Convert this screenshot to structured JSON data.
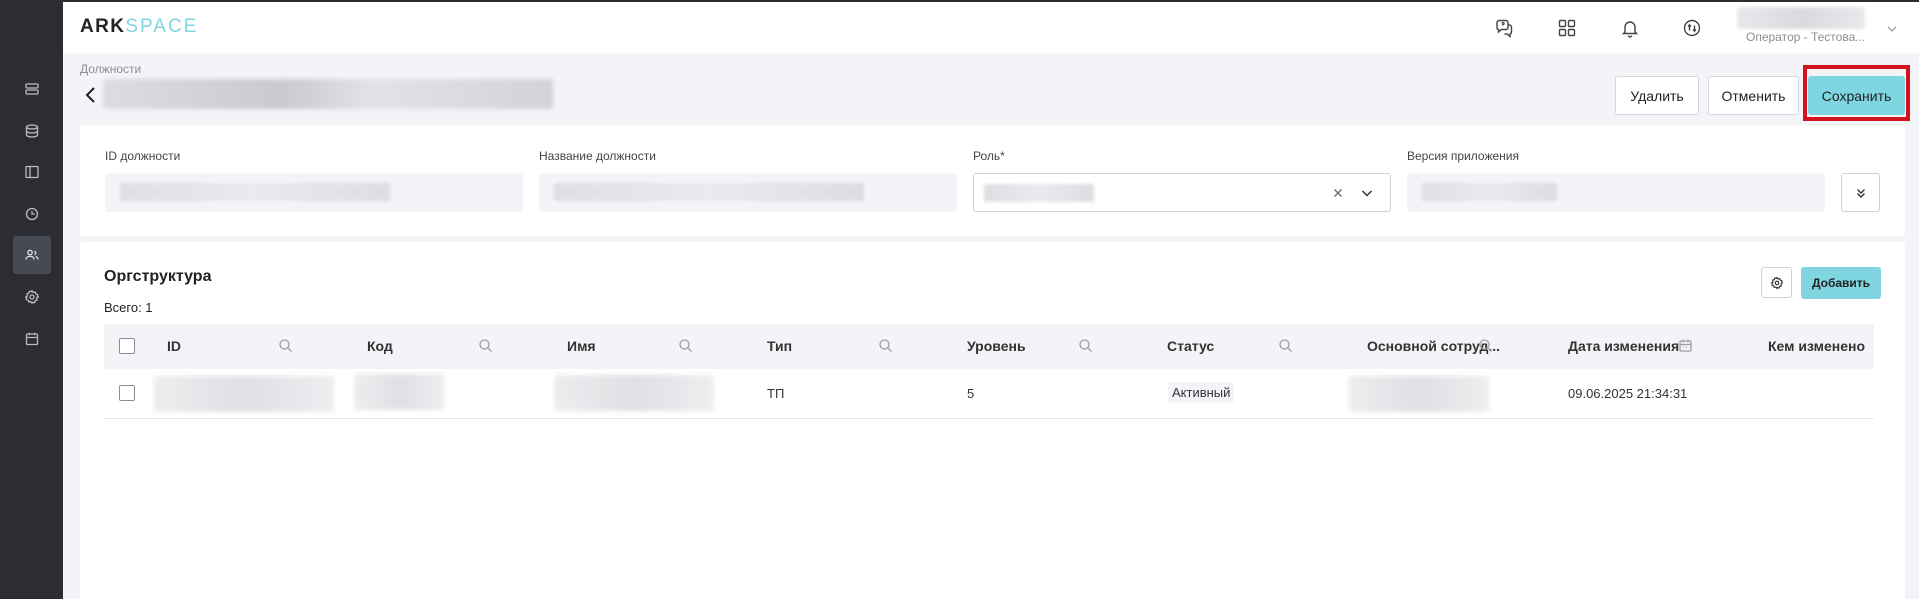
{
  "app": {
    "logo_part1": "ARK",
    "logo_part2": "SPACE"
  },
  "header": {
    "user_role": "Оператор - Тестова..."
  },
  "page": {
    "breadcrumb": "Должности"
  },
  "actions": {
    "delete_label": "Удалить",
    "cancel_label": "Отменить",
    "save_label": "Сохранить"
  },
  "form": {
    "id_label": "ID должности",
    "name_label": "Название должности",
    "role_label": "Роль*",
    "version_label": "Версия приложения"
  },
  "orgstructure": {
    "title": "Оргструктура",
    "total": "Всего: 1",
    "add_label": "Добавить",
    "columns": [
      "ID",
      "Код",
      "Имя",
      "Тип",
      "Уровень",
      "Статус",
      "Основной сотруд...",
      "Дата изменения",
      "Кем изменено"
    ],
    "rows": [
      {
        "type": "ТП",
        "level": "5",
        "status": "Активный",
        "changed_at": "09.06.2025 21:34:31"
      }
    ]
  },
  "colors": {
    "accent": "#7fd5e0",
    "sidebar": "#2b2d33",
    "highlight": "#d4111e"
  }
}
